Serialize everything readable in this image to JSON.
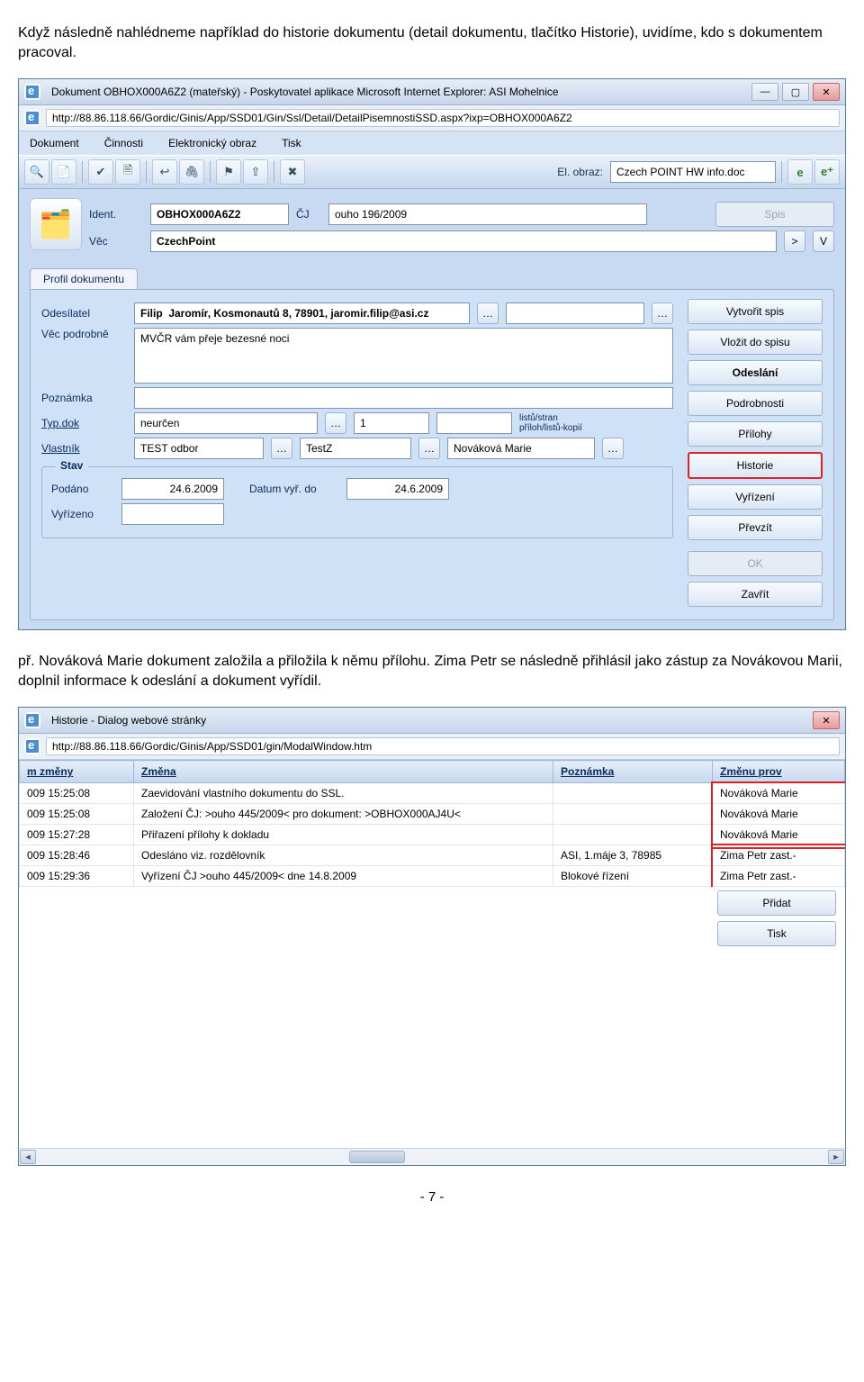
{
  "intro_paragraph": "Když následně nahlédneme například do historie dokumentu (detail dokumentu, tlačítko Historie), uvidíme, kdo s dokumentem pracoval.",
  "mid_paragraph": "př. Nováková Marie dokument založila a přiložila k němu přílohu. Zima Petr se následně přihlásil jako zástup za Novákovou Marii, doplnil informace k odeslání a dokument vyřídil.",
  "page_number": "- 7 -",
  "doc_window": {
    "title": "Dokument OBHOX000A6Z2 (mateřský) - Poskytovatel aplikace Microsoft Internet Explorer: ASI Mohelnice",
    "url": "http://88.86.118.66/Gordic/Ginis/App/SSD01/Gin/Ssl/Detail/DetailPisemnostiSSD.aspx?ixp=OBHOX000A6Z2",
    "menu": [
      "Dokument",
      "Činnosti",
      "Elektronický obraz",
      "Tisk"
    ],
    "el_obraz_label": "El. obraz:",
    "el_obraz_value": "Czech POINT HW info.doc",
    "ident_label": "Ident.",
    "ident_value": "OBHOX000A6Z2",
    "cj_label": "ČJ",
    "cj_value": "ouho 196/2009",
    "spis_btn": "Spis",
    "vec_label": "Věc",
    "vec_value": "CzechPoint",
    "profile_tab": "Profil dokumentu",
    "rows": {
      "odesilatel_label": "Odesílatel",
      "odesilatel_value": "Filip  Jaromír, Kosmonautů 8, 78901, jaromir.filip@asi.cz",
      "vecpod_label": "Věc podrobně",
      "vecpod_value": "MVČR vám přeje bezesné noci",
      "poznamka_label": "Poznámka",
      "typdok_label": "Typ.dok",
      "typdok_value": "neurčen",
      "count_value": "1",
      "count_label1": "listů/stran",
      "count_label2": "příloh/listů-kopií",
      "vlastnik_label": "Vlastník",
      "vlastnik_value1": "TEST odbor",
      "vlastnik_value2": "TestZ",
      "vlastnik_value3": "Nováková Marie"
    },
    "stav": {
      "legend": "Stav",
      "podano_label": "Podáno",
      "podano_value": "24.6.2009",
      "datumvyr_label": "Datum vyř. do",
      "datumvyr_value": "24.6.2009",
      "vyrizeno_label": "Vyřízeno"
    },
    "right_buttons": [
      {
        "label": "Vytvořit spis",
        "bold": false
      },
      {
        "label": "Vložit do spisu",
        "bold": false
      },
      {
        "label": "Odeslání",
        "bold": true
      },
      {
        "label": "Podrobnosti",
        "bold": false
      },
      {
        "label": "Přílohy",
        "bold": false
      },
      {
        "label": "Historie",
        "bold": false,
        "highlight": true
      },
      {
        "label": "Vyřízení",
        "bold": false
      },
      {
        "label": "Převzít",
        "bold": false
      }
    ],
    "ok_btn": "OK",
    "zavrit_btn": "Zavřít"
  },
  "history_dialog": {
    "title": "Historie - Dialog webové stránky",
    "url": "http://88.86.118.66/Gordic/Ginis/App/SSD01/gin/ModalWindow.htm",
    "columns": [
      "m změny",
      "Změna",
      "Poznámka",
      "Změnu prov"
    ],
    "rows": [
      {
        "t": "009 15:25:08",
        "z": "Zaevidování vlastního dokumentu do SSL.",
        "p": "",
        "u": "Nováková Marie"
      },
      {
        "t": "009 15:25:08",
        "z": "Založení ČJ: >ouho 445/2009< pro dokument: >OBHOX000AJ4U<",
        "p": "",
        "u": "Nováková Marie"
      },
      {
        "t": "009 15:27:28",
        "z": "Přiřazení přílohy k dokladu",
        "p": "",
        "u": "Nováková Marie"
      },
      {
        "t": "009 15:28:46",
        "z": "Odesláno viz. rozdělovník",
        "p": "ASI, 1.máje 3, 78985",
        "u": "Zima Petr zast.-"
      },
      {
        "t": "009 15:29:36",
        "z": "Vyřízení ČJ >ouho 445/2009< dne 14.8.2009",
        "p": "Blokové řízení",
        "u": "Zima Petr zast.-"
      }
    ],
    "pridat_btn": "Přidat",
    "tisk_btn": "Tisk"
  }
}
